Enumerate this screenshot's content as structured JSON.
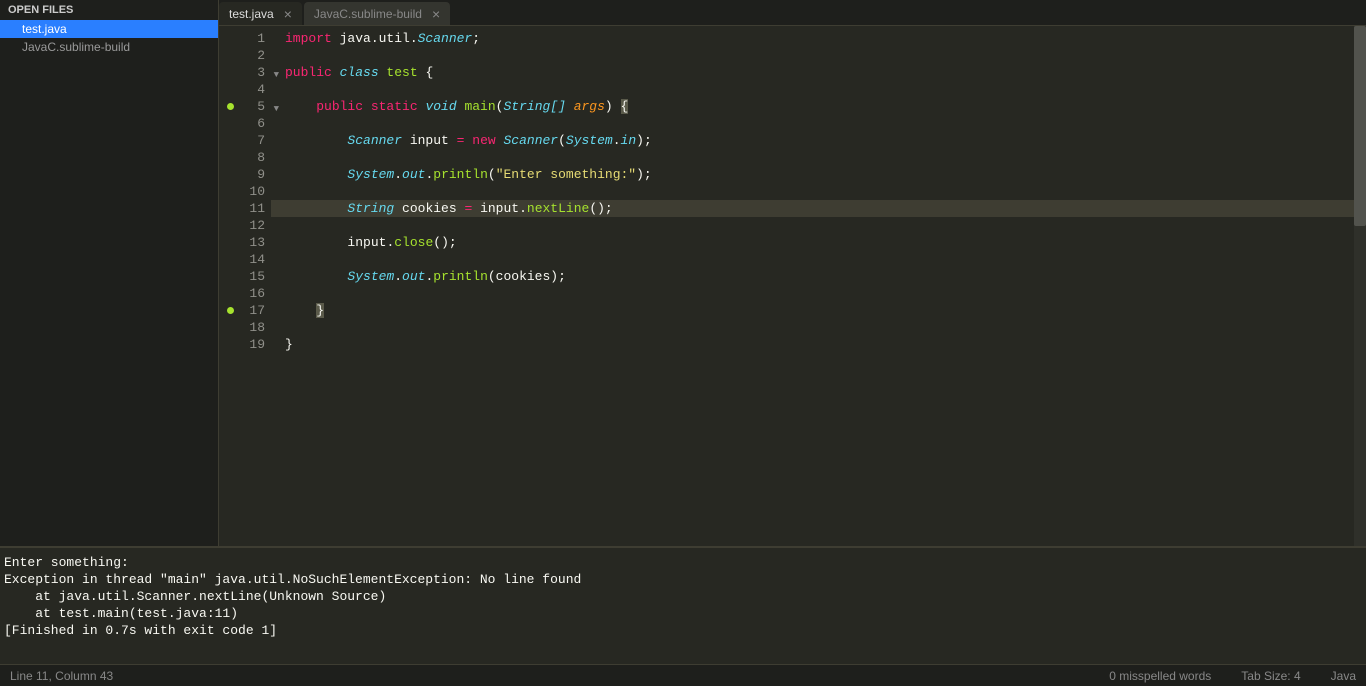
{
  "sidebar": {
    "header": "OPEN FILES",
    "items": [
      {
        "label": "test.java",
        "active": true
      },
      {
        "label": "JavaC.sublime-build",
        "active": false
      }
    ]
  },
  "tabs": [
    {
      "label": "test.java",
      "active": true
    },
    {
      "label": "JavaC.sublime-build",
      "active": false
    }
  ],
  "currentLine": 11,
  "gutter": {
    "dots": {
      "5": "#a6e22e",
      "17": "#a6e22e"
    },
    "folds": {
      "3": "▼",
      "5": "▼"
    },
    "count": 19
  },
  "code": [
    [
      [
        "import ",
        "k-import"
      ],
      [
        "java.util.",
        "k-pkg"
      ],
      [
        "Scanner",
        "k-type"
      ],
      [
        ";",
        "k-punc"
      ]
    ],
    [],
    [
      [
        "public ",
        "k-mod"
      ],
      [
        "class ",
        "k-type"
      ],
      [
        "test",
        "k-name"
      ],
      [
        " {",
        "k-punc"
      ]
    ],
    [],
    [
      [
        "    ",
        ""
      ],
      [
        "public ",
        "k-mod"
      ],
      [
        "static ",
        "k-mod"
      ],
      [
        "void ",
        "k-type"
      ],
      [
        "main",
        "k-fn"
      ],
      [
        "(",
        "k-punc"
      ],
      [
        "String",
        "k-type"
      ],
      [
        "[] ",
        "k-type"
      ],
      [
        "args",
        "k-param"
      ],
      [
        ") ",
        "k-punc"
      ],
      [
        "{",
        "k-punc k-brace-hl"
      ]
    ],
    [],
    [
      [
        "        ",
        ""
      ],
      [
        "Scanner",
        "k-type"
      ],
      [
        " input ",
        "k-plain"
      ],
      [
        "=",
        "k-op"
      ],
      [
        " ",
        "k-plain"
      ],
      [
        "new ",
        "k-new"
      ],
      [
        "Scanner",
        "k-type"
      ],
      [
        "(",
        "k-punc"
      ],
      [
        "System",
        "k-type"
      ],
      [
        ".",
        "k-punc"
      ],
      [
        "in",
        "k-const"
      ],
      [
        ");",
        "k-punc"
      ]
    ],
    [],
    [
      [
        "        ",
        ""
      ],
      [
        "System",
        "k-type"
      ],
      [
        ".",
        "k-punc"
      ],
      [
        "out",
        "k-const"
      ],
      [
        ".",
        "k-punc"
      ],
      [
        "println",
        "k-fn"
      ],
      [
        "(",
        "k-punc"
      ],
      [
        "\"Enter something:\"",
        "k-str"
      ],
      [
        ");",
        "k-punc"
      ]
    ],
    [],
    [
      [
        "        ",
        ""
      ],
      [
        "String",
        "k-type"
      ],
      [
        " cookies ",
        "k-plain"
      ],
      [
        "=",
        "k-op"
      ],
      [
        " input",
        "k-plain"
      ],
      [
        ".",
        "k-punc"
      ],
      [
        "nextLine",
        "k-fn"
      ],
      [
        "();",
        "k-punc"
      ]
    ],
    [],
    [
      [
        "        ",
        ""
      ],
      [
        "input",
        "k-plain"
      ],
      [
        ".",
        "k-punc"
      ],
      [
        "close",
        "k-fn"
      ],
      [
        "();",
        "k-punc"
      ]
    ],
    [],
    [
      [
        "        ",
        ""
      ],
      [
        "System",
        "k-type"
      ],
      [
        ".",
        "k-punc"
      ],
      [
        "out",
        "k-const"
      ],
      [
        ".",
        "k-punc"
      ],
      [
        "println",
        "k-fn"
      ],
      [
        "(cookies);",
        "k-punc"
      ]
    ],
    [],
    [
      [
        "    ",
        ""
      ],
      [
        "}",
        "k-punc k-brace-hl"
      ]
    ],
    [],
    [
      [
        "}",
        "k-punc"
      ]
    ]
  ],
  "console": [
    "Enter something:",
    "Exception in thread \"main\" java.util.NoSuchElementException: No line found",
    "    at java.util.Scanner.nextLine(Unknown Source)",
    "    at test.main(test.java:11)",
    "[Finished in 0.7s with exit code 1]"
  ],
  "status": {
    "left": "Line 11, Column 43",
    "spell": "0 misspelled words",
    "tab": "Tab Size: 4",
    "lang": "Java"
  }
}
